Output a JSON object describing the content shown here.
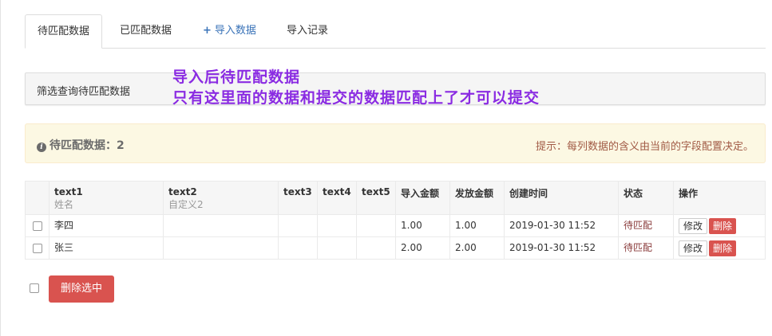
{
  "tabs": [
    {
      "label": "待匹配数据",
      "active": true
    },
    {
      "label": "已匹配数据"
    },
    {
      "label": "导入数据",
      "icon": "plus-icon"
    },
    {
      "label": "导入记录"
    }
  ],
  "filter": {
    "label": "筛选查询待匹配数据"
  },
  "annotation": {
    "line1": "导入后待匹配数据",
    "line2": "只有这里面的数据和提交的数据匹配上了才可以提交"
  },
  "alert": {
    "label": "待匹配数据：",
    "count": "2",
    "hint": "提示：每列数据的含义由当前的字段配置决定。"
  },
  "table": {
    "headers": [
      {
        "title": "text1",
        "sub": "姓名"
      },
      {
        "title": "text2",
        "sub": "自定义2"
      },
      {
        "title": "text3"
      },
      {
        "title": "text4"
      },
      {
        "title": "text5"
      },
      {
        "title": "导入金额"
      },
      {
        "title": "发放金额"
      },
      {
        "title": "创建时间"
      },
      {
        "title": "状态"
      },
      {
        "title": "操作"
      }
    ],
    "rows": [
      {
        "text1": "李四",
        "text2": "",
        "text3": "",
        "text4": "",
        "text5": "",
        "import_amount": "1.00",
        "pay_amount": "1.00",
        "created": "2019-01-30 11:52",
        "status": "待匹配"
      },
      {
        "text1": "张三",
        "text2": "",
        "text3": "",
        "text4": "",
        "text5": "",
        "import_amount": "2.00",
        "pay_amount": "2.00",
        "created": "2019-01-30 11:52",
        "status": "待匹配"
      }
    ],
    "edit_label": "修改",
    "delete_label": "删除"
  },
  "bulk_delete_label": "删除选中",
  "colors": {
    "accent": "#3a73b8",
    "danger": "#d9534f",
    "annotation": "#8a2be2",
    "alert_bg": "#fcf8e3"
  }
}
